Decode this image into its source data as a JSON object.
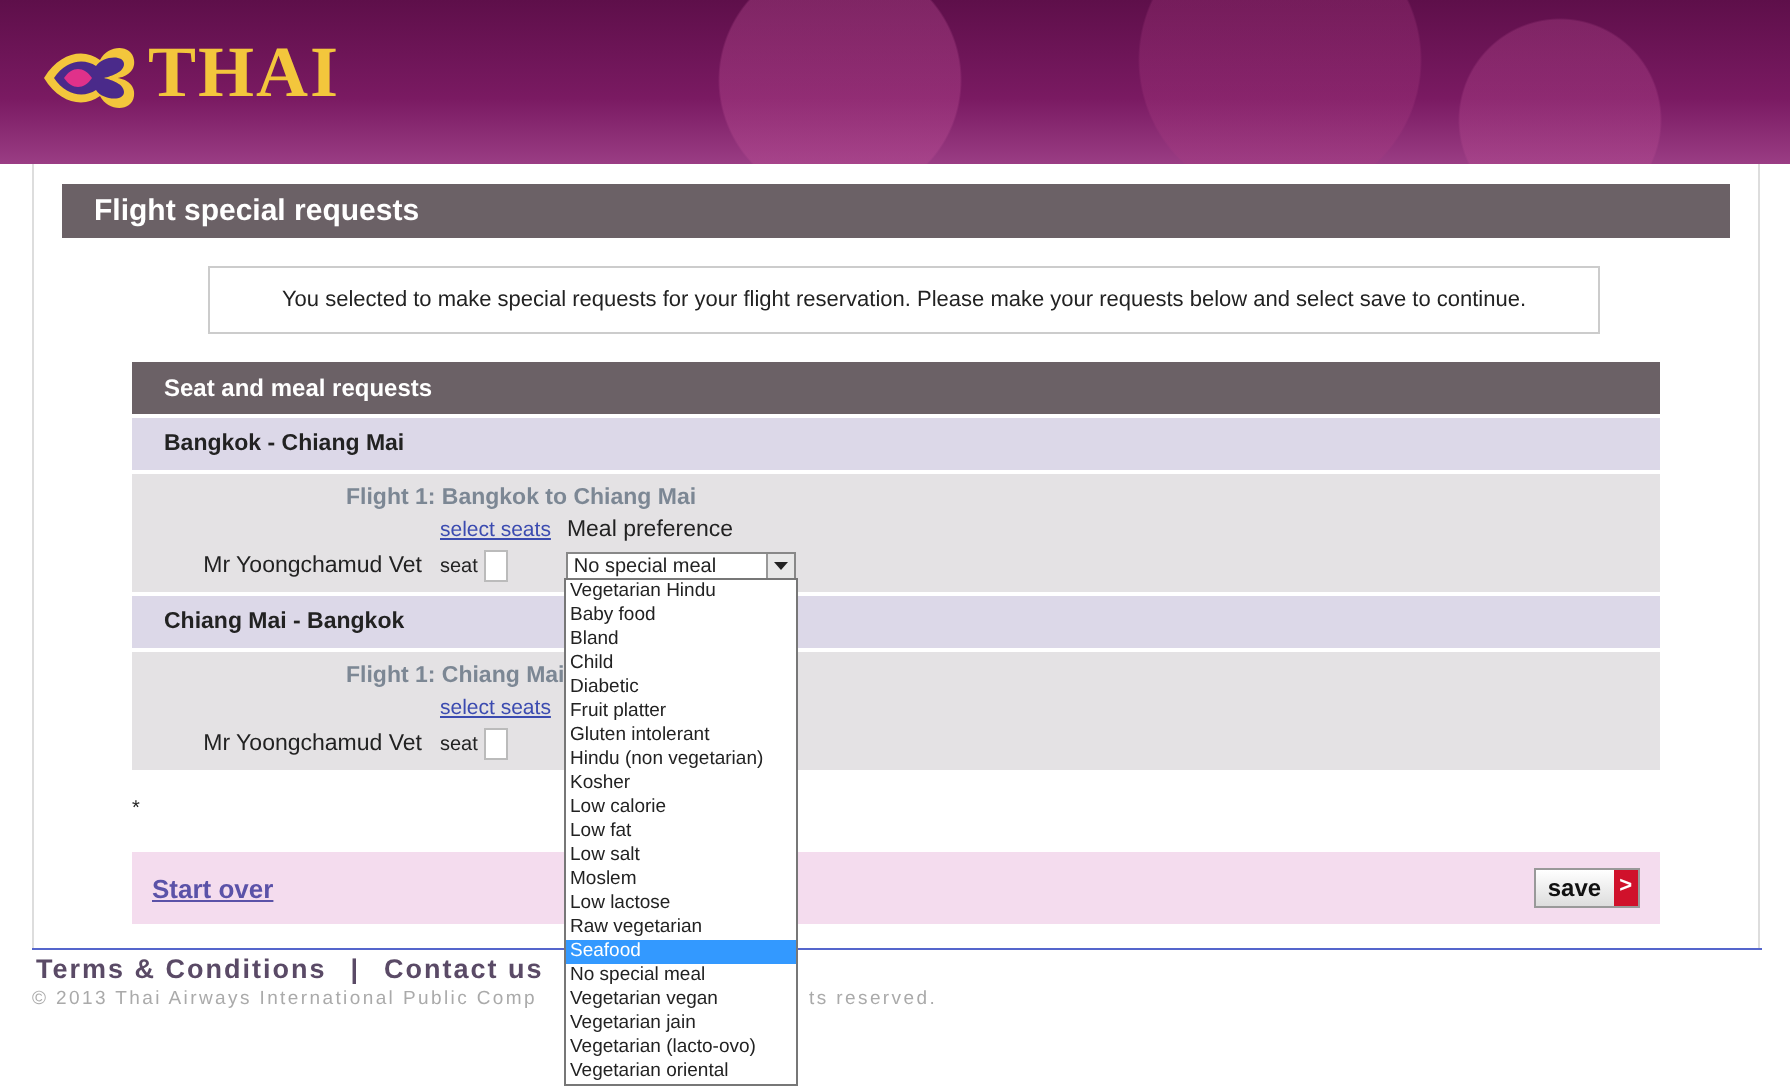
{
  "logo": {
    "text": "THAI"
  },
  "page_title": "Flight special requests",
  "info": "You selected to make special requests for your flight reservation. Please make your requests below and select save to continue.",
  "requests": {
    "title": "Seat and meal requests",
    "sections": [
      {
        "route": "Bangkok - Chiang Mai",
        "flight": "Flight 1: Bangkok to Chiang Mai",
        "select_seats": "select seats",
        "meal_label": "Meal preference",
        "passenger": "Mr Yoongchamud Vet",
        "seat_label": "seat",
        "meal": "No special meal"
      },
      {
        "route": "Chiang Mai - Bangkok",
        "flight": "Flight 1: Chiang Mai",
        "select_seats": "select seats",
        "passenger": "Mr Yoongchamud Vet",
        "seat_label": "seat"
      }
    ]
  },
  "note": "*",
  "start_over": "Start over",
  "save": "save",
  "save_arrow": ">",
  "footer": {
    "links": [
      "Terms & Conditions",
      "Contact us"
    ],
    "separator": "|",
    "copyright_left": "© 2013 Thai Airways International Public Comp",
    "copyright_right": "ts reserved."
  },
  "dropdown": {
    "options": [
      {
        "label": "Vegetarian Hindu",
        "selected": false
      },
      {
        "label": "Baby food",
        "selected": false
      },
      {
        "label": "Bland",
        "selected": false
      },
      {
        "label": "Child",
        "selected": false
      },
      {
        "label": "Diabetic",
        "selected": false
      },
      {
        "label": "Fruit platter",
        "selected": false
      },
      {
        "label": "Gluten intolerant",
        "selected": false
      },
      {
        "label": "Hindu (non vegetarian)",
        "selected": false
      },
      {
        "label": "Kosher",
        "selected": false
      },
      {
        "label": "Low calorie",
        "selected": false
      },
      {
        "label": "Low fat",
        "selected": false
      },
      {
        "label": "Low salt",
        "selected": false
      },
      {
        "label": "Moslem",
        "selected": false
      },
      {
        "label": "Low lactose",
        "selected": false
      },
      {
        "label": "Raw vegetarian",
        "selected": false
      },
      {
        "label": "Seafood",
        "selected": true
      },
      {
        "label": "No special meal",
        "selected": false
      },
      {
        "label": "Vegetarian vegan",
        "selected": false
      },
      {
        "label": "Vegetarian jain",
        "selected": false
      },
      {
        "label": "Vegetarian (lacto-ovo)",
        "selected": false
      },
      {
        "label": "Vegetarian oriental",
        "selected": false
      }
    ]
  }
}
